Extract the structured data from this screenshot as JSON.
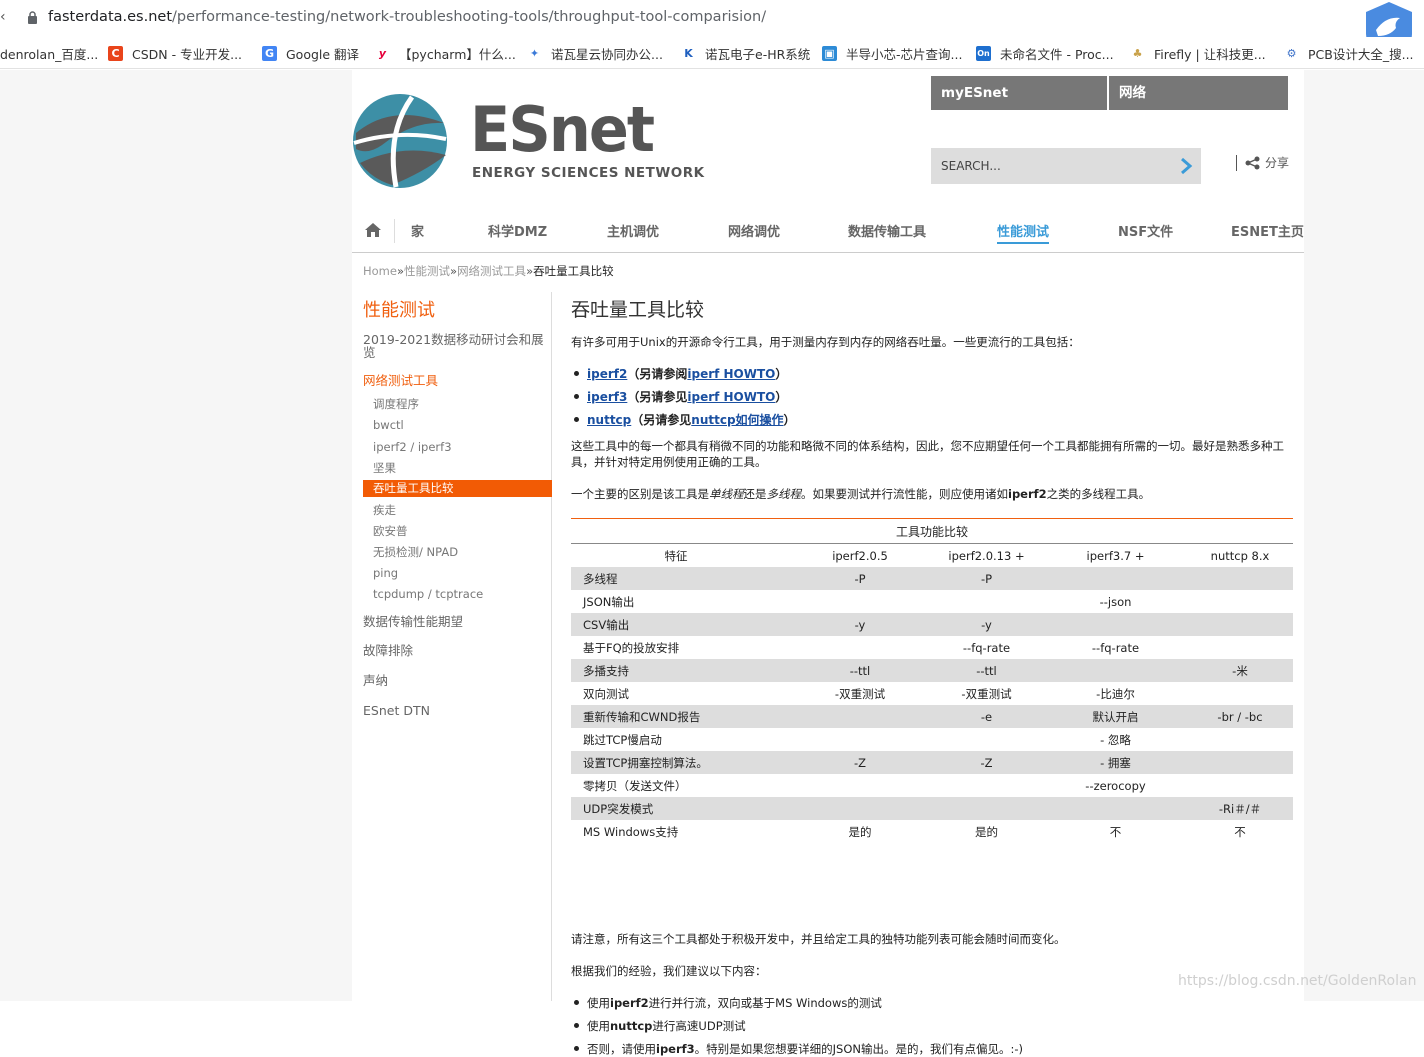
{
  "browser": {
    "url_host": "fasterdata.es.net",
    "url_path": "/performance-testing/network-troubleshooting-tools/throughput-tool-comparision/",
    "bookmarks": [
      {
        "label": "denrolan_百度...",
        "icon": "paw-icon",
        "color": "#2f5bd7"
      },
      {
        "label": "CSDN - 专业开发...",
        "icon": "csdn-icon",
        "color": "#e9441b"
      },
      {
        "label": "Google 翻译",
        "icon": "translate-icon",
        "color": "#4285f4"
      },
      {
        "label": "【pycharm】什么...",
        "icon": "yahoo-icon",
        "color": "#e6003b"
      },
      {
        "label": "诺瓦星云协同办公...",
        "icon": "star-icon",
        "color": "#3b7ad8"
      },
      {
        "label": "诺瓦电子e-HR系统",
        "icon": "k-icon",
        "color": "#1f5fbf"
      },
      {
        "label": "半导小芯-芯片查询...",
        "icon": "chip-icon",
        "color": "#2d8bd6"
      },
      {
        "label": "未命名文件 - Proc...",
        "icon": "on-icon",
        "color": "#1e6fcf"
      },
      {
        "label": "Firefly | 让科技更...",
        "icon": "firefly-icon",
        "color": "#c9a24a"
      },
      {
        "label": "PCB设计大全_搜...",
        "icon": "pcb-icon",
        "color": "#3f73c9"
      }
    ]
  },
  "header": {
    "logo_word": "ESnet",
    "logo_sub": "ENERGY SCIENCES NETWORK",
    "top_buttons": [
      "myESnet",
      "网络"
    ],
    "search_placeholder": "SEARCH...",
    "share_label": "分享"
  },
  "nav": {
    "items": [
      "家",
      "科学DMZ",
      "主机调优",
      "网络调优",
      "数据传输工具",
      "性能测试",
      "NSF文件",
      "ESNET主页"
    ],
    "active": "性能测试"
  },
  "breadcrumb": {
    "home": "Home",
    "sep": "»",
    "l1": "性能测试",
    "l2": "网络测试工具",
    "current": "吞吐量工具比较"
  },
  "sidebar": {
    "heading": "性能测试",
    "item_2019": "2019-2021数据移动研讨会和展览",
    "group": "网络测试工具",
    "subitems": [
      "调度程序",
      "bwctl",
      "iperf2 / iperf3",
      "坚果",
      "吞吐量工具比较",
      "疾走",
      "欧安普",
      "无损检测/ NPAD",
      "ping",
      "tcpdump / tcptrace"
    ],
    "selected": "吞吐量工具比较",
    "items": [
      "数据传输性能期望",
      "故障排除",
      "声纳",
      "ESnet DTN"
    ]
  },
  "main": {
    "title": "吞吐量工具比较",
    "intro": "有许多可用于Unix的开源命令行工具，用于测量内存到内存的网络吞吐量。一些更流行的工具包括：",
    "tools": [
      {
        "name": "iperf2",
        "pre": "（另请参阅",
        "link": "iperf HOWTO",
        "post": "）"
      },
      {
        "name": "iperf3",
        "pre": "（另请参见",
        "link": "iperf HOWTO",
        "post": "）"
      },
      {
        "name": "nuttcp",
        "pre": "（另请参见",
        "link": "nuttcp如何操作",
        "post": "）"
      }
    ],
    "para2": "这些工具中的每一个都具有稍微不同的功能和略微不同的体系结构，因此，您不应期望任何一个工具都能拥有所需的一切。最好是熟悉多种工具，并针对特定用例使用正确的工具。",
    "para3_a": "一个主要的区别是该工具是",
    "para3_b": "单线程",
    "para3_c": "还是",
    "para3_d": "多线程",
    "para3_e": "。如果要测试并行流性能，则应使用诸如",
    "para3_f": "iperf2",
    "para3_g": "之类的多线程工具。",
    "table": {
      "caption": "工具功能比较",
      "headers": [
        "特征",
        "iperf2.0.5",
        "iperf2.0.13 +",
        "iperf3.7 +",
        "nuttcp 8.x"
      ],
      "rows": [
        [
          "多线程",
          "-P",
          "-P",
          "",
          ""
        ],
        [
          "JSON输出",
          "",
          "",
          "--json",
          ""
        ],
        [
          "CSV输出",
          "-y",
          "-y",
          "",
          ""
        ],
        [
          "基于FQ的投放安排",
          "",
          "--fq-rate",
          "--fq-rate",
          ""
        ],
        [
          "多播支持",
          "--ttl",
          "--ttl",
          "",
          "-米"
        ],
        [
          "双向测试",
          "-双重测试",
          "-双重测试",
          "-比迪尔",
          ""
        ],
        [
          "重新传输和CWND报告",
          "",
          "-e",
          "默认开启",
          "-br / -bc"
        ],
        [
          "跳过TCP慢启动",
          "",
          "",
          "- 忽略",
          ""
        ],
        [
          "设置TCP拥塞控制算法。",
          "-Z",
          "-Z",
          "- 拥塞",
          ""
        ],
        [
          "零拷贝（发送文件）",
          "",
          "",
          "--zerocopy",
          ""
        ],
        [
          "UDP突发模式",
          "",
          "",
          "",
          "-Ri＃/＃"
        ],
        [
          "MS Windows支持",
          "是的",
          "是的",
          "不",
          "不"
        ]
      ]
    },
    "para4": "请注意，所有这三个工具都处于积极开发中，并且给定工具的独特功能列表可能会随时间而变化。",
    "para5": "根据我们的经验，我们建议以下内容：",
    "recs": [
      {
        "pre": "使用",
        "bold": "iperf2",
        "post": "进行并行流，双向或基于MS Windows的测试"
      },
      {
        "pre": "使用",
        "bold": "nuttcp",
        "post": "进行高速UDP测试"
      },
      {
        "pre": "否则，请使用",
        "bold": "iperf3",
        "post": "。特别是如果您想要详细的JSON输出。是的，我们有点偏见。:-)"
      }
    ]
  },
  "watermark": "https://blog.csdn.net/GoldenRolan"
}
